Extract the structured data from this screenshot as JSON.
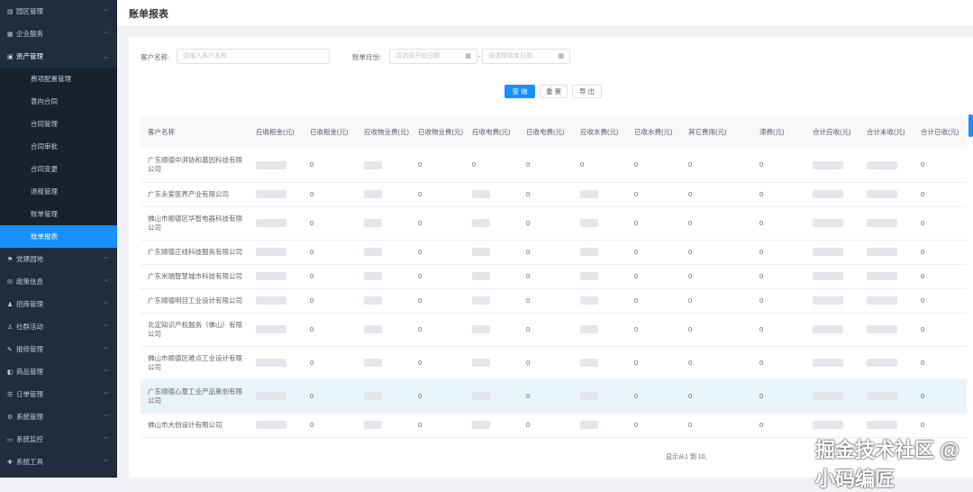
{
  "sidebar": {
    "items": [
      {
        "label": "园区管理",
        "icon": "building-icon"
      },
      {
        "label": "企业服务",
        "icon": "grid-icon"
      },
      {
        "label": "资产管理",
        "icon": "clipboard-icon",
        "open": true,
        "children": [
          "费项配置管理",
          "意向合同",
          "合同管理",
          "合同审批",
          "合同变更",
          "退租管理",
          "账单管理",
          "账单报表"
        ]
      },
      {
        "label": "党建园地",
        "icon": "flag-icon"
      },
      {
        "label": "政策信息",
        "icon": "message-icon"
      },
      {
        "label": "招商管理",
        "icon": "users-icon"
      },
      {
        "label": "社群活动",
        "icon": "person-icon"
      },
      {
        "label": "报修管理",
        "icon": "wrench-icon"
      },
      {
        "label": "商品管理",
        "icon": "bag-icon"
      },
      {
        "label": "订单管理",
        "icon": "list-icon"
      },
      {
        "label": "系统管理",
        "icon": "gear-icon"
      },
      {
        "label": "系统监控",
        "icon": "monitor-icon"
      },
      {
        "label": "系统工具",
        "icon": "tool-icon"
      }
    ],
    "active": "账单报表"
  },
  "page": {
    "title": "账单报表"
  },
  "filters": {
    "customer_label": "客户名称:",
    "customer_placeholder": "请输入客户名称",
    "month_label": "账单月份:",
    "start_placeholder": "请选择开始日期",
    "sep": "-",
    "end_placeholder": "请选择结束日期"
  },
  "buttons": {
    "search": "查 询",
    "reset": "重 置",
    "export": "导 出"
  },
  "table": {
    "columns": [
      "客户名称",
      "应收租金(元)",
      "已收租金(元)",
      "应收物业费(元)",
      "已收物业费(元)",
      "应收电费(元)",
      "已收电费(元)",
      "应收水费(元)",
      "已收水费(元)",
      "其它费用(元)",
      "滞费(元)",
      "合计应收(元)",
      "合计未收(元)",
      "合计已收(元)"
    ],
    "rows": [
      {
        "name": "广东顺德中湃协和基因科技有限公司",
        "values": [
          "",
          "0",
          "",
          "0",
          "0",
          "0",
          "0",
          "0",
          "0",
          "0",
          "",
          "",
          "0"
        ]
      },
      {
        "name": "广东永爱医养产业有限公司",
        "values": [
          "",
          "0",
          "",
          "0",
          "",
          "0",
          "",
          "0",
          "0",
          "0",
          "",
          "",
          "0"
        ]
      },
      {
        "name": "佛山市顺德区华智电器科技有限公司",
        "values": [
          "",
          "0",
          "",
          "0",
          "",
          "0",
          "",
          "0",
          "0",
          "0",
          "",
          "",
          "0"
        ]
      },
      {
        "name": "广东顺德正线科技服务有限公司",
        "values": [
          "",
          "0",
          "",
          "0",
          "",
          "0",
          "",
          "0",
          "0",
          "0",
          "",
          "",
          "0"
        ]
      },
      {
        "name": "广东米瑞智慧城市科技有限公司",
        "values": [
          "",
          "0",
          "",
          "0",
          "",
          "0",
          "",
          "0",
          "0",
          "0",
          "",
          "",
          "0"
        ]
      },
      {
        "name": "广东顺德明目工业设计有限公司",
        "values": [
          "",
          "0",
          "",
          "0",
          "",
          "0",
          "",
          "0",
          "0",
          "0",
          "",
          "",
          "0"
        ]
      },
      {
        "name": "北定知识产权服务（佛山）有限公司",
        "values": [
          "",
          "0",
          "",
          "0",
          "",
          "0",
          "",
          "0",
          "0",
          "0",
          "",
          "",
          "0"
        ]
      },
      {
        "name": "佛山市顺德区难点工业设计有限公司",
        "values": [
          "",
          "0",
          "",
          "0",
          "",
          "0",
          "",
          "0",
          "0",
          "0",
          "",
          "",
          "0"
        ]
      },
      {
        "name": "广东顺德心意工业产品策划有限公司",
        "values": [
          "",
          "0",
          "",
          "0",
          "",
          "0",
          "",
          "0",
          "0",
          "0",
          "",
          "",
          "0"
        ],
        "highlight": true
      },
      {
        "name": "佛山市大创设计有限公司",
        "values": [
          "",
          "0",
          "",
          "0",
          "",
          "0",
          "",
          "0",
          "0",
          "0",
          "",
          "",
          "0"
        ]
      }
    ]
  },
  "pager": {
    "text": "显示从1 到 10,"
  },
  "watermark": "掘金技术社区 @ 小码编匠"
}
